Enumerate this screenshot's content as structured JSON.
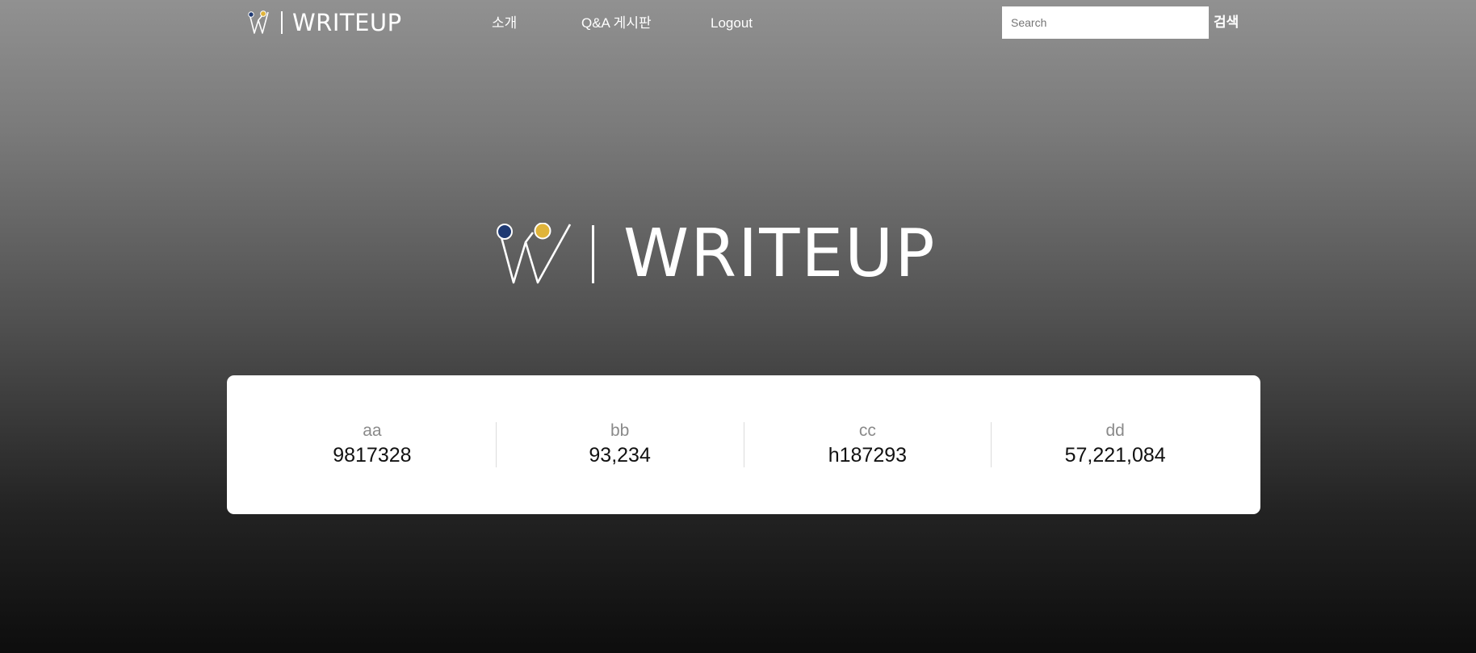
{
  "header": {
    "brand": "WRITEUP",
    "nav": [
      {
        "label": "소개"
      },
      {
        "label": "Q&A 게시판"
      },
      {
        "label": "Logout"
      }
    ],
    "search": {
      "placeholder": "Search",
      "button_label": "검색"
    }
  },
  "hero": {
    "brand": "WRITEUP"
  },
  "stats": [
    {
      "label": "aa",
      "value": "9817328"
    },
    {
      "label": "bb",
      "value": "93,234"
    },
    {
      "label": "cc",
      "value": "h187293"
    },
    {
      "label": "dd",
      "value": "57,221,084"
    }
  ],
  "colors": {
    "logo_dot_blue": "#1f3a73",
    "logo_dot_yellow": "#e0b43a",
    "background_top": "#919191",
    "background_bottom": "#0d0d0d",
    "card": "#ffffff"
  }
}
